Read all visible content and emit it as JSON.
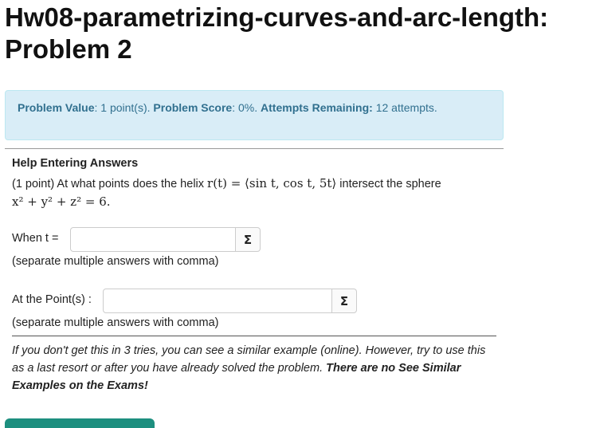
{
  "header": {
    "title_line1": "Hw08-parametrizing-curves-and-arc-length:",
    "title_line2": "Problem 2"
  },
  "info": {
    "value_label": "Problem Value",
    "value_text": ": 1 point(s).",
    "score_label": "Problem Score",
    "score_text": ": 0%.",
    "attempts_label": "Attempts Remaining:",
    "attempts_text": " 12 attempts."
  },
  "problem": {
    "help_link": "Help Entering Answers",
    "text_before": "(1 point) At what points does the helix ",
    "math_helix": "r(t) = ⟨sin t, cos t, 5t⟩",
    "text_after": " intersect the sphere",
    "math_sphere": "x² + y² + z² = 6."
  },
  "answers": {
    "t_label": "When t =",
    "t_value": "",
    "t_note": "(separate multiple answers with comma)",
    "point_label": "At the Point(s) :",
    "point_value": "",
    "point_note": "(separate multiple answers with comma)",
    "sigma_symbol": "Σ"
  },
  "hint": {
    "text": "If you don't get this in 3 tries, you can see a similar example (online). However, try to use this as a last resort or after you have already solved the problem. ",
    "bold_text": "There are no See Similar Examples on the Exams!"
  },
  "colors": {
    "info_bg": "#d9edf7",
    "info_text": "#31708f",
    "button_teal": "#1d8f7f"
  }
}
